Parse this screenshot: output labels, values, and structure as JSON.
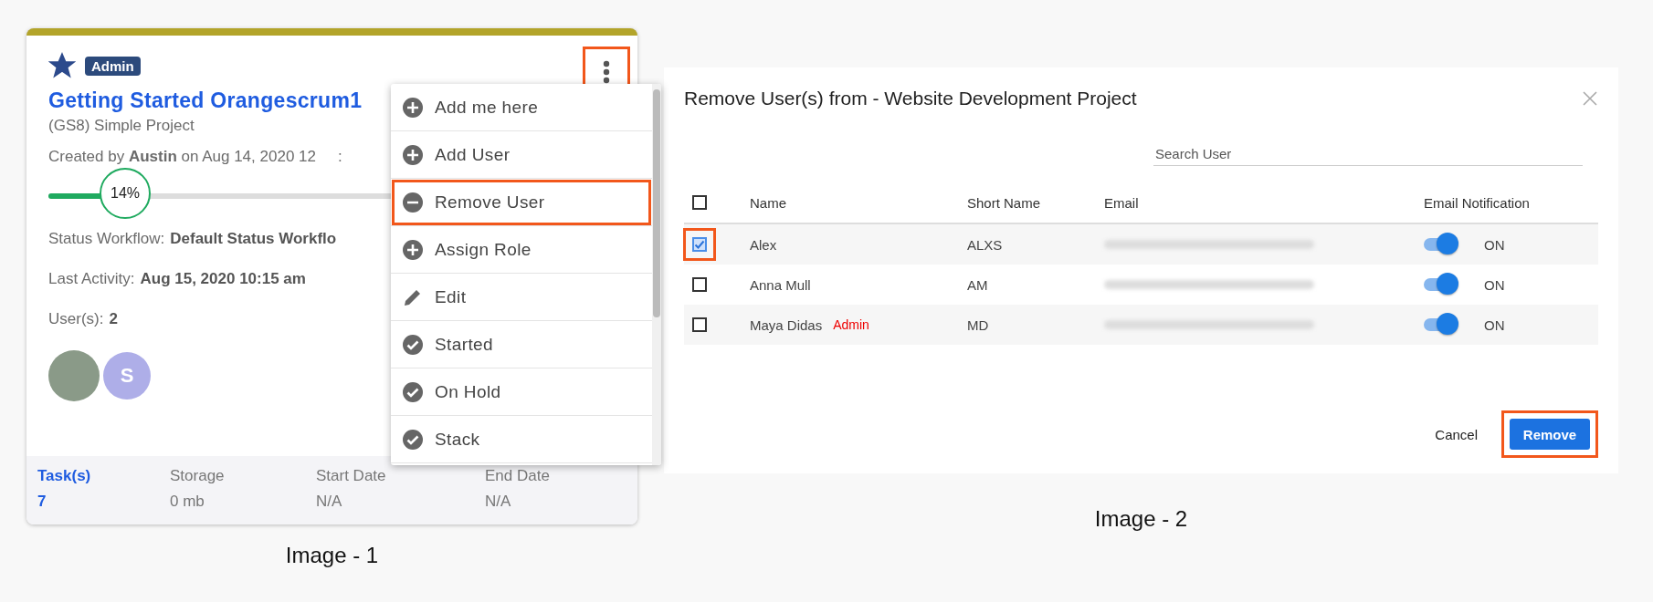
{
  "project_card": {
    "starred": true,
    "badge": "Admin",
    "title": "Getting Started Orangescrum1",
    "subtitle": "(GS8) Simple Project",
    "created": "Created by **Austin** on Aug 14, 2020 12",
    "created_tail": ":",
    "progress": {
      "level": 0.14,
      "reading": "14%"
    },
    "status_workflow": {
      "label": "Status Workflow:",
      "value": "Default Status Workflo"
    },
    "last_activity": {
      "label": "Last Activity:",
      "value": "Aug 15, 2020 10:15 am"
    },
    "users": {
      "label": "User(s):",
      "value": "2"
    },
    "avatars": [
      {
        "kind": "photo"
      },
      {
        "kind": "letter",
        "letter": "S"
      }
    ],
    "menu_button": {
      "highlighted": true
    },
    "footer": [
      {
        "label": "Task(s)",
        "value": "7",
        "link": true
      },
      {
        "label": "Storage",
        "value": "0 mb",
        "link": false
      },
      {
        "label": "Start Date",
        "value": "N/A",
        "link": false
      },
      {
        "label": "End Date",
        "value": "N/A",
        "link": false
      }
    ],
    "menu": [
      {
        "label": "Add me here",
        "kind": "plus",
        "highlighted": false
      },
      {
        "label": "Add User",
        "kind": "plus",
        "highlighted": false
      },
      {
        "label": "Remove User",
        "kind": "minus",
        "highlighted": true
      },
      {
        "label": "Assign Role",
        "kind": "plus",
        "highlighted": false
      },
      {
        "label": "Edit",
        "kind": "edit",
        "highlighted": false
      },
      {
        "label": "Started",
        "kind": "check",
        "highlighted": false
      },
      {
        "label": "On Hold",
        "kind": "check",
        "highlighted": false
      },
      {
        "label": "Stack",
        "kind": "check",
        "highlighted": false
      }
    ]
  },
  "dialog": {
    "title": "Remove User(s) from -  Website Development Project",
    "search": {
      "placeholder": "Search User"
    },
    "columns": [
      "Name",
      "Short Name",
      "Email",
      "Email Notification"
    ],
    "select_all": {
      "checked": false
    },
    "rows": [
      {
        "name": "Alex",
        "role": "",
        "short": "ALXS",
        "checked": true,
        "highlighted": true,
        "notify": {
          "on": true,
          "label": "ON"
        }
      },
      {
        "name": "Anna Mull",
        "role": "",
        "short": "AM",
        "checked": false,
        "highlighted": false,
        "notify": {
          "on": true,
          "label": "ON"
        }
      },
      {
        "name": "Maya Didas",
        "role": "Admin",
        "short": "MD",
        "checked": false,
        "highlighted": false,
        "notify": {
          "on": true,
          "label": "ON"
        }
      }
    ],
    "buttons": {
      "cancel": "Cancel",
      "remove": "Remove",
      "remove_highlighted": true
    }
  },
  "captions": [
    "Image - 1",
    "Image - 2"
  ]
}
